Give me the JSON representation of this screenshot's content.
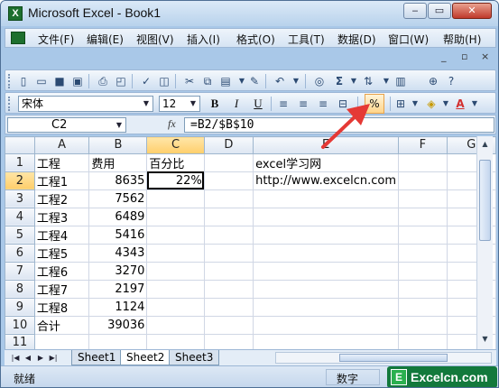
{
  "window": {
    "title": "Microsoft Excel - Book1",
    "min": "‒",
    "max": "▭",
    "close": "✕"
  },
  "menubar": {
    "items": [
      "文件(F)",
      "编辑(E)",
      "视图(V)",
      "插入(I)",
      "格式(O)",
      "工具(T)",
      "数据(D)",
      "窗口(W)",
      "帮助(H)"
    ],
    "right_controls": [
      "_",
      "▫",
      "×"
    ]
  },
  "toolbar_standard": {
    "icons": [
      "new-icon",
      "open-icon",
      "save-icon",
      "permission-icon",
      "print-icon",
      "print-preview-icon",
      "spelling-icon",
      "research-icon",
      "cut-icon",
      "copy-icon",
      "paste-icon",
      "format-painter-icon",
      "undo-icon",
      "hyperlink-icon",
      "autosum-icon",
      "sort-ascending-icon",
      "chart-icon",
      "help-icon"
    ],
    "autosum_glyph": "Σ"
  },
  "toolbar_format": {
    "font": "宋体",
    "size": "12",
    "bold": "B",
    "italic": "I",
    "underline": "U",
    "percent": "%",
    "font_color_letter": "A"
  },
  "formula_bar": {
    "name_box": "C2",
    "fx": "fx",
    "formula": "=B2/$B$10"
  },
  "grid": {
    "columns": [
      "A",
      "B",
      "C",
      "D",
      "E",
      "F",
      "G"
    ],
    "rows": [
      {
        "n": "1",
        "cells": [
          "工程",
          "费用",
          "百分比",
          "",
          "excel学习网",
          "",
          ""
        ]
      },
      {
        "n": "2",
        "cells": [
          "工程1",
          "8635",
          "22%",
          "",
          "http://www.excelcn.com",
          "",
          ""
        ]
      },
      {
        "n": "3",
        "cells": [
          "工程2",
          "7562",
          "",
          "",
          "",
          "",
          ""
        ]
      },
      {
        "n": "4",
        "cells": [
          "工程3",
          "6489",
          "",
          "",
          "",
          "",
          ""
        ]
      },
      {
        "n": "5",
        "cells": [
          "工程4",
          "5416",
          "",
          "",
          "",
          "",
          ""
        ]
      },
      {
        "n": "6",
        "cells": [
          "工程5",
          "4343",
          "",
          "",
          "",
          "",
          ""
        ]
      },
      {
        "n": "7",
        "cells": [
          "工程6",
          "3270",
          "",
          "",
          "",
          "",
          ""
        ]
      },
      {
        "n": "8",
        "cells": [
          "工程7",
          "2197",
          "",
          "",
          "",
          "",
          ""
        ]
      },
      {
        "n": "9",
        "cells": [
          "工程8",
          "1124",
          "",
          "",
          "",
          "",
          ""
        ]
      },
      {
        "n": "10",
        "cells": [
          "合计",
          "39036",
          "",
          "",
          "",
          "",
          ""
        ]
      },
      {
        "n": "11",
        "cells": [
          "",
          "",
          "",
          "",
          "",
          "",
          ""
        ]
      },
      {
        "n": "12",
        "cells": [
          "",
          "",
          "",
          "",
          "",
          "",
          ""
        ]
      }
    ],
    "active_cell": "C2"
  },
  "sheet_tabs": [
    "Sheet1",
    "Sheet2",
    "Sheet3"
  ],
  "active_sheet": "Sheet2",
  "status": {
    "ready": "就绪",
    "mode": "数字"
  },
  "watermark": {
    "letter": "E",
    "text": "Excelcn.com"
  },
  "colors": {
    "accent": "#e8a24a",
    "arrow": "#e53935",
    "brand": "#13793c"
  }
}
